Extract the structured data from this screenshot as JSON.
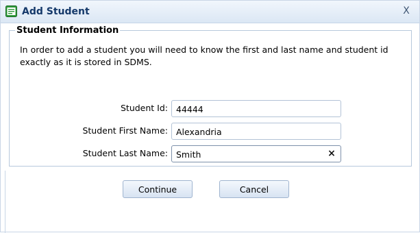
{
  "dialog": {
    "title": "Add Student",
    "close_glyph": "X",
    "title_icon": "form-icon"
  },
  "section": {
    "legend": "Student Information",
    "instructions": "In order to add a student you will need to know the first and last name and student id exactly as it is stored in SDMS."
  },
  "form": {
    "student_id": {
      "label": "Student Id:",
      "value": "44444"
    },
    "first_name": {
      "label": "Student First Name:",
      "value": "Alexandria"
    },
    "last_name": {
      "label": "Student Last Name:",
      "value": "Smith",
      "clear_glyph": "×"
    }
  },
  "buttons": {
    "continue_label": "Continue",
    "cancel_label": "Cancel"
  },
  "colors": {
    "title_text": "#15396a",
    "titlebar_top": "#f1f6fc",
    "titlebar_bottom": "#dbe7f4",
    "border": "#b7c8dc"
  }
}
